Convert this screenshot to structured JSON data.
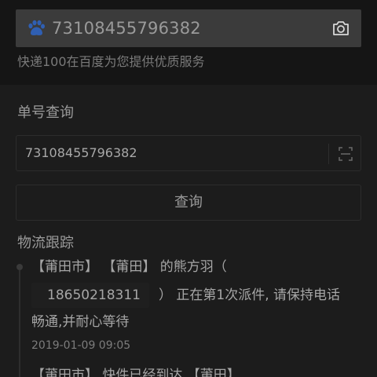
{
  "search": {
    "query": "73108455796382",
    "subtitle": "快递100在百度为您提供优质服务"
  },
  "tracking": {
    "section_title": "单号查询",
    "input_value": "73108455796382",
    "query_button_label": "查询"
  },
  "logistics": {
    "title": "物流跟踪",
    "events": [
      {
        "line1": "【莆田市】 【莆田】 的熊方羽（",
        "phone": "18650218311",
        "line2": "） 正在第1次派件, 请保持电话",
        "line3": "畅通,并耐心等待",
        "time": "2019-01-09 09:05"
      },
      {
        "line1": "【莆田市】 快件已经到达 【莆田】"
      }
    ]
  },
  "icons": {
    "search_logo": "paw-icon",
    "camera": "camera-icon",
    "scan": "scan-icon"
  },
  "colors": {
    "background": "#1c1c1c",
    "top_band": "#151515",
    "search_box": "#3b3b3b",
    "text": "#9a9a9a",
    "logo_blue": "#2f5fb3"
  }
}
